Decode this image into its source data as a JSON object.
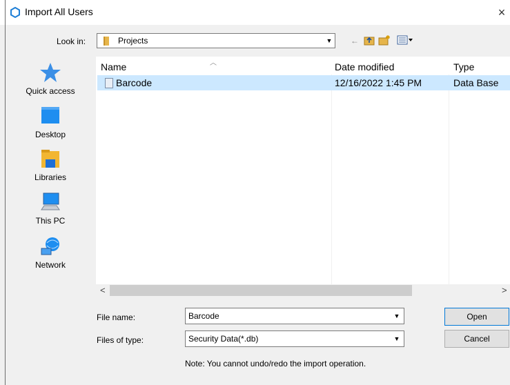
{
  "window": {
    "title": "Import All Users",
    "close": "×"
  },
  "lookin": {
    "label": "Look in:",
    "value": "Projects"
  },
  "toolbar": {
    "back_icon": "←",
    "up_icon": "⇧",
    "new_folder_icon": "✚",
    "view_icon": "▦▾"
  },
  "places": [
    {
      "label": "Quick access",
      "icon": "star-icon"
    },
    {
      "label": "Desktop",
      "icon": "desktop-icon"
    },
    {
      "label": "Libraries",
      "icon": "libraries-icon"
    },
    {
      "label": "This PC",
      "icon": "computer-icon"
    },
    {
      "label": "Network",
      "icon": "network-icon"
    }
  ],
  "filelist": {
    "columns": [
      "Name",
      "Date modified",
      "Type"
    ],
    "rows": [
      {
        "name": "Barcode",
        "date": "12/16/2022 1:45 PM",
        "type": "Data Base"
      }
    ],
    "scroll_left": "<",
    "scroll_right": ">"
  },
  "form": {
    "filename_label": "File name:",
    "filename_value": "Barcode",
    "filetype_label": "Files of type:",
    "filetype_value": "Security Data(*.db)",
    "open_label": "Open",
    "cancel_label": "Cancel",
    "note": "Note: You cannot undo/redo the import operation."
  },
  "colors": {
    "selection": "#cce8ff",
    "accent": "#0078d7"
  }
}
